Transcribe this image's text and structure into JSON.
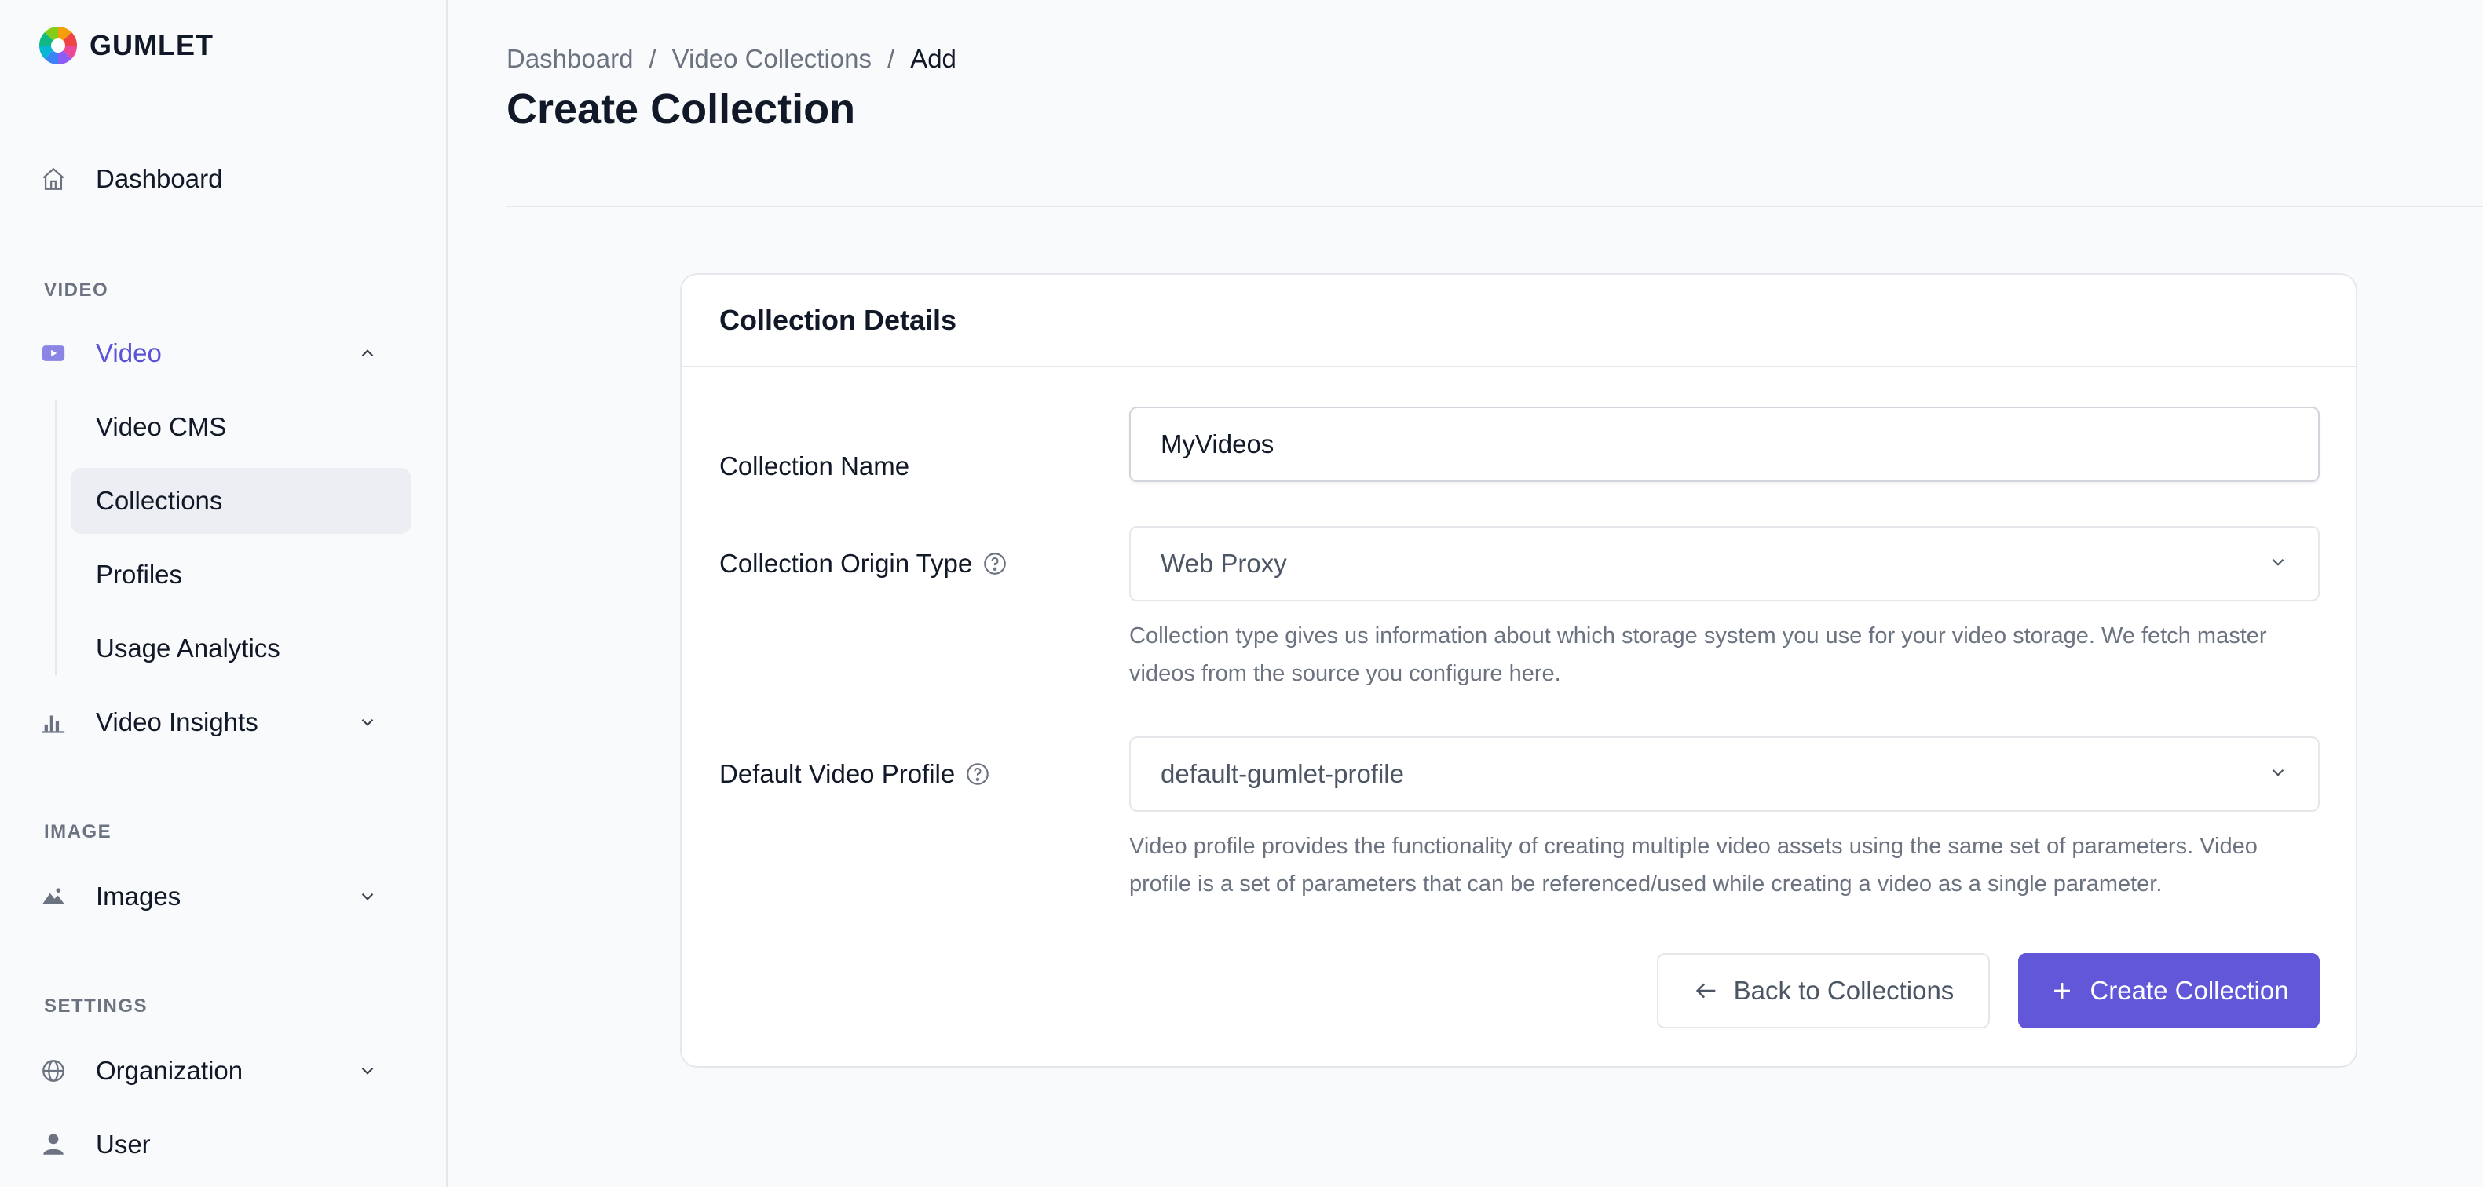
{
  "app": {
    "name": "GUMLET"
  },
  "sidebar": {
    "dashboard": "Dashboard",
    "sections": {
      "video": "VIDEO",
      "image": "IMAGE",
      "settings": "SETTINGS"
    },
    "video": "Video",
    "video_sub": [
      "Video CMS",
      "Collections",
      "Profiles",
      "Usage Analytics"
    ],
    "video_insights": "Video Insights",
    "images": "Images",
    "organization": "Organization",
    "user": "User"
  },
  "breadcrumb": [
    "Dashboard",
    "Video Collections",
    "Add"
  ],
  "breadcrumb_sep": "/",
  "page": {
    "title": "Create Collection"
  },
  "card": {
    "title": "Collection Details",
    "name_label": "Collection Name",
    "name_value": "MyVideos",
    "origin_label": "Collection Origin Type",
    "origin_value": "Web Proxy",
    "origin_help": "Collection type gives us information about which storage system you use for your video storage. We fetch master videos from the source you configure here.",
    "profile_label": "Default Video Profile",
    "profile_value": "default-gumlet-profile",
    "profile_help": "Video profile provides the functionality of creating multiple video assets using the same set of parameters. Video profile is a set of parameters that can be referenced/used while creating a video as a single parameter.",
    "back_button": "Back to Collections",
    "create_button": "Create Collection"
  },
  "colors": {
    "accent": "#6257d9",
    "active_bg": "#eceef3",
    "muted": "#6b7280"
  }
}
